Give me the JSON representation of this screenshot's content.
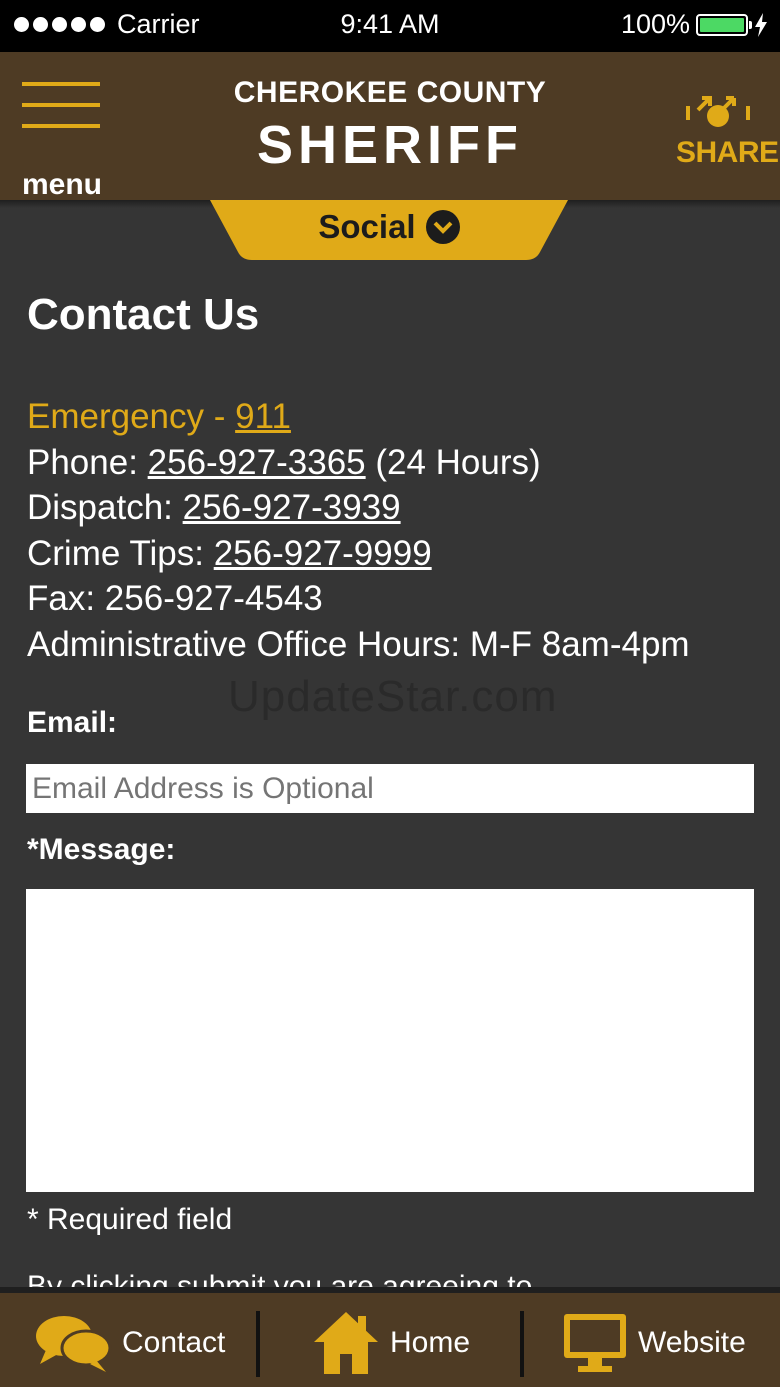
{
  "status_bar": {
    "carrier": "Carrier",
    "time": "9:41 AM",
    "battery": "100%"
  },
  "header": {
    "menu_label": "menu",
    "title_line1": "CHEROKEE COUNTY",
    "title_line2": "SHERIFF",
    "share_label": "SHARE"
  },
  "social_tab": {
    "label": "Social"
  },
  "contact": {
    "heading": "Contact Us",
    "emergency_label": "Emergency - ",
    "emergency_number": "911",
    "phone_label": "Phone: ",
    "phone_number": "256-927-3365",
    "phone_suffix": " (24 Hours)",
    "dispatch_label": "Dispatch: ",
    "dispatch_number": "256-927-3939",
    "tips_label": "Crime Tips: ",
    "tips_number": "256-927-9999",
    "fax_text": "Fax: 256-927-4543",
    "hours_text": "Administrative Office Hours: M-F 8am-4pm"
  },
  "watermark": "UpdateStar.com",
  "form": {
    "email_label": "Email:",
    "email_placeholder": "Email Address is Optional",
    "message_label": "*Message:",
    "message_value": "",
    "required_note": "* Required field",
    "cutoff_text": "By clicking submit you are agreeing to"
  },
  "bottom_nav": {
    "contact": "Contact",
    "home": "Home",
    "website": "Website"
  },
  "colors": {
    "brown": "#4e3b24",
    "gold": "#e0aa18",
    "background": "#353535"
  }
}
